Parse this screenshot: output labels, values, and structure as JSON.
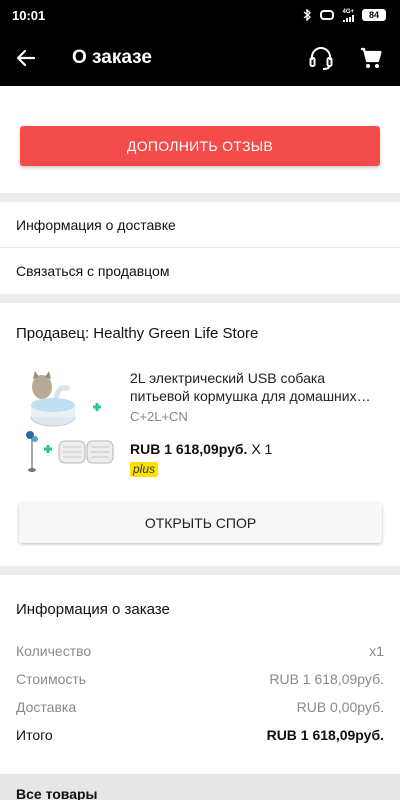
{
  "status_bar": {
    "time": "10:01",
    "network": "4G+",
    "battery": "84"
  },
  "header": {
    "title": "О заказе",
    "back_icon": "arrow-left-icon",
    "support_icon": "headset-icon",
    "cart_icon": "cart-icon"
  },
  "review": {
    "button_label": "ДОПОЛНИТЬ ОТЗЫВ",
    "color": "#f44b4b"
  },
  "menu": {
    "items": [
      "Информация о доставке",
      "Связаться с продавцом"
    ]
  },
  "seller": {
    "name": "Продавец: Healthy Green Life Store",
    "product": {
      "title": "2L электрический USB собака питьевой кормушка для домашних…",
      "variant": "C+2L+CN",
      "price": "RUB 1 618,09руб.",
      "qty": "X 1",
      "badge": "plus"
    },
    "dispute_label": "ОТКРЫТЬ СПОР"
  },
  "order_info": {
    "title": "Информация о заказе",
    "rows": [
      {
        "label": "Количество",
        "value": "x1"
      },
      {
        "label": "Стоимость",
        "value": "RUB 1 618,09руб."
      },
      {
        "label": "Доставка",
        "value": "RUB 0,00руб."
      },
      {
        "label": "Итого",
        "value": "RUB 1 618,09руб."
      }
    ]
  },
  "all_goods": {
    "label": "Все товары"
  }
}
